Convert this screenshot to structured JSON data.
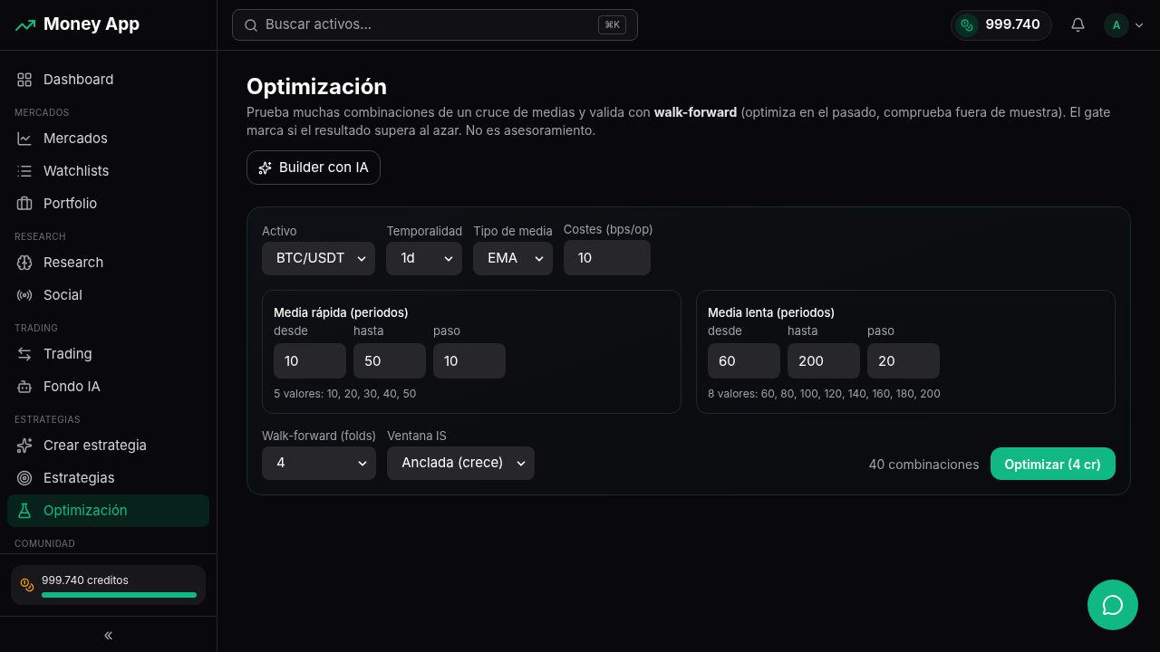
{
  "app": {
    "name": "Money App"
  },
  "sidebar": {
    "sections": [
      {
        "items": [
          {
            "label": "Dashboard",
            "selected": false
          }
        ]
      },
      {
        "label": "MERCADOS",
        "items": [
          {
            "label": "Mercados",
            "selected": false
          },
          {
            "label": "Watchlists",
            "selected": false
          },
          {
            "label": "Portfolio",
            "selected": false
          }
        ]
      },
      {
        "label": "RESEARCH",
        "items": [
          {
            "label": "Research",
            "selected": false
          },
          {
            "label": "Social",
            "selected": false
          }
        ]
      },
      {
        "label": "TRADING",
        "items": [
          {
            "label": "Trading",
            "selected": false
          },
          {
            "label": "Fondo IA",
            "selected": false
          }
        ]
      },
      {
        "label": "ESTRATEGIAS",
        "items": [
          {
            "label": "Crear estrategia",
            "selected": false
          },
          {
            "label": "Estrategias",
            "selected": false
          },
          {
            "label": "Optimización",
            "selected": true
          }
        ]
      },
      {
        "label": "COMUNIDAD"
      }
    ],
    "credits": {
      "text": "999.740 creditos",
      "level": 1
    },
    "collapse": "«"
  },
  "header": {
    "search": {
      "placeholder": "Buscar activos...",
      "shortcut": "⌘K"
    },
    "balance": "999.740",
    "avatar": "A"
  },
  "page": {
    "title": "Optimización",
    "description": "Prueba muchas combinaciones de un cruce de medias y valida con **walk-forward** (optimiza en el pasado, comprueba fuera de muestra). El gate marca si el resultado supera al azar. No es asesoramiento.",
    "builder_button": "Builder con IA"
  },
  "form": {
    "top_fields": [
      {
        "kind": "select",
        "label": "Activo",
        "value": "BTC/USDT"
      },
      {
        "kind": "select",
        "label": "Temporalidad",
        "value": "1d"
      },
      {
        "kind": "select",
        "label": "Tipo de media",
        "value": "EMA"
      },
      {
        "kind": "input",
        "label": "Costes (bps/op)",
        "value": "10"
      }
    ],
    "ranges": [
      {
        "title": "Media rápida (periodos)",
        "fields": [
          {
            "label": "desde",
            "value": "10"
          },
          {
            "label": "hasta",
            "value": "50"
          },
          {
            "label": "paso",
            "value": "10"
          }
        ],
        "summary": "5 valores: 10, 20, 30, 40, 50"
      },
      {
        "title": "Media lenta (periodos)",
        "fields": [
          {
            "label": "desde",
            "value": "60"
          },
          {
            "label": "hasta",
            "value": "200"
          },
          {
            "label": "paso",
            "value": "20"
          }
        ],
        "summary": "8 valores: 60, 80, 100, 120, 140, 160, 180, 200"
      }
    ],
    "bottom_fields": [
      {
        "kind": "select",
        "label": "Walk-forward (folds)",
        "value": "4"
      },
      {
        "kind": "select",
        "label": "Ventana IS",
        "value": "Anclada (crece)"
      }
    ],
    "combinations": "40 combinaciones",
    "submit": "Optimizar (4 cr)"
  }
}
